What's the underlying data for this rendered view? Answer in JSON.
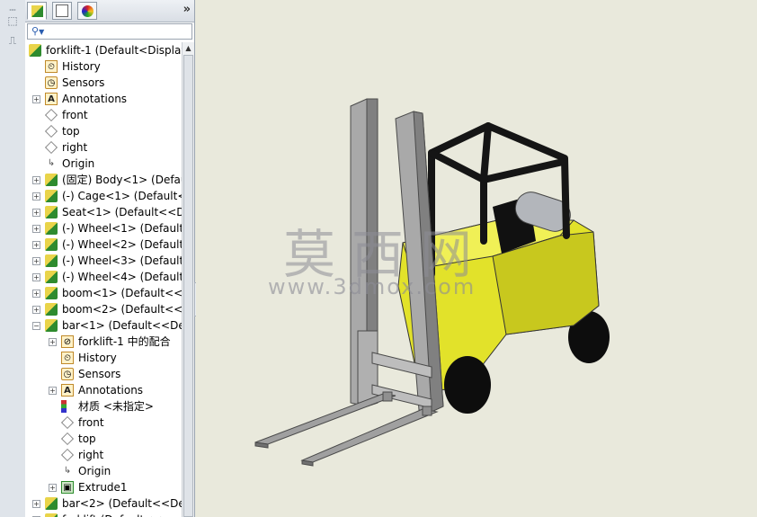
{
  "feature_tree": {
    "tabs": [
      {
        "icon": "feature-manager-icon"
      },
      {
        "icon": "property-manager-icon"
      },
      {
        "icon": "appearance-icon"
      }
    ],
    "expand_symbol": "»",
    "filter_symbol": "▼",
    "rows": [
      {
        "label": "forklift-1  (Default<Display",
        "icon": "assembly-icon",
        "indent": 0,
        "expand": ""
      },
      {
        "label": "History",
        "icon": "history-icon",
        "indent": 1,
        "expand": ""
      },
      {
        "label": "Sensors",
        "icon": "sensors-icon",
        "indent": 1,
        "expand": ""
      },
      {
        "label": "Annotations",
        "icon": "annotations-icon",
        "indent": 1,
        "expand": "+"
      },
      {
        "label": "front",
        "icon": "plane-icon",
        "indent": 1,
        "expand": ""
      },
      {
        "label": "top",
        "icon": "plane-icon",
        "indent": 1,
        "expand": ""
      },
      {
        "label": "right",
        "icon": "plane-icon",
        "indent": 1,
        "expand": ""
      },
      {
        "label": "Origin",
        "icon": "origin-icon",
        "indent": 1,
        "expand": ""
      },
      {
        "label": "(固定) Body<1> (Defau",
        "icon": "part-icon",
        "indent": 1,
        "expand": "+"
      },
      {
        "label": "(-) Cage<1> (Default<",
        "icon": "part-icon",
        "indent": 1,
        "expand": "+"
      },
      {
        "label": "Seat<1> (Default<<De",
        "icon": "part-icon",
        "indent": 1,
        "expand": "+"
      },
      {
        "label": "(-) Wheel<1> (Default<",
        "icon": "part-icon",
        "indent": 1,
        "expand": "+"
      },
      {
        "label": "(-) Wheel<2> (Default<",
        "icon": "part-icon",
        "indent": 1,
        "expand": "+"
      },
      {
        "label": "(-) Wheel<3> (Default<",
        "icon": "part-icon",
        "indent": 1,
        "expand": "+"
      },
      {
        "label": "(-) Wheel<4> (Default<",
        "icon": "part-icon",
        "indent": 1,
        "expand": "+"
      },
      {
        "label": "boom<1> (Default<<D",
        "icon": "part-icon",
        "indent": 1,
        "expand": "+"
      },
      {
        "label": "boom<2> (Default<<D",
        "icon": "part-icon",
        "indent": 1,
        "expand": "+"
      },
      {
        "label": "bar<1> (Default<<Def",
        "icon": "part-icon",
        "indent": 1,
        "expand": "−"
      },
      {
        "label": "forklift-1 中的配合",
        "icon": "mates-icon",
        "indent": 2,
        "expand": "+"
      },
      {
        "label": "History",
        "icon": "history-icon",
        "indent": 2,
        "expand": ""
      },
      {
        "label": "Sensors",
        "icon": "sensors-icon",
        "indent": 2,
        "expand": ""
      },
      {
        "label": "Annotations",
        "icon": "annotations-icon",
        "indent": 2,
        "expand": "+"
      },
      {
        "label": "材质 <未指定>",
        "icon": "material-icon",
        "indent": 2,
        "expand": ""
      },
      {
        "label": "front",
        "icon": "plane-icon",
        "indent": 2,
        "expand": ""
      },
      {
        "label": "top",
        "icon": "plane-icon",
        "indent": 2,
        "expand": ""
      },
      {
        "label": "right",
        "icon": "plane-icon",
        "indent": 2,
        "expand": ""
      },
      {
        "label": "Origin",
        "icon": "origin-icon",
        "indent": 2,
        "expand": ""
      },
      {
        "label": "Extrude1",
        "icon": "extrude-icon",
        "indent": 2,
        "expand": "+"
      },
      {
        "label": "bar<2> (Default<<Def",
        "icon": "part-icon",
        "indent": 1,
        "expand": "+"
      },
      {
        "label": "forklift (Default<<...",
        "icon": "part-icon",
        "indent": 1,
        "expand": "+"
      }
    ]
  },
  "viewport": {
    "watermark_cn": "莫西网",
    "watermark_url": "www.3dmox.com",
    "colors": {
      "background": "#e9e9dc",
      "body": "#e6e62a",
      "mast": "#9c9c9c",
      "tire": "#0d0d0d",
      "cage": "#151515"
    }
  }
}
